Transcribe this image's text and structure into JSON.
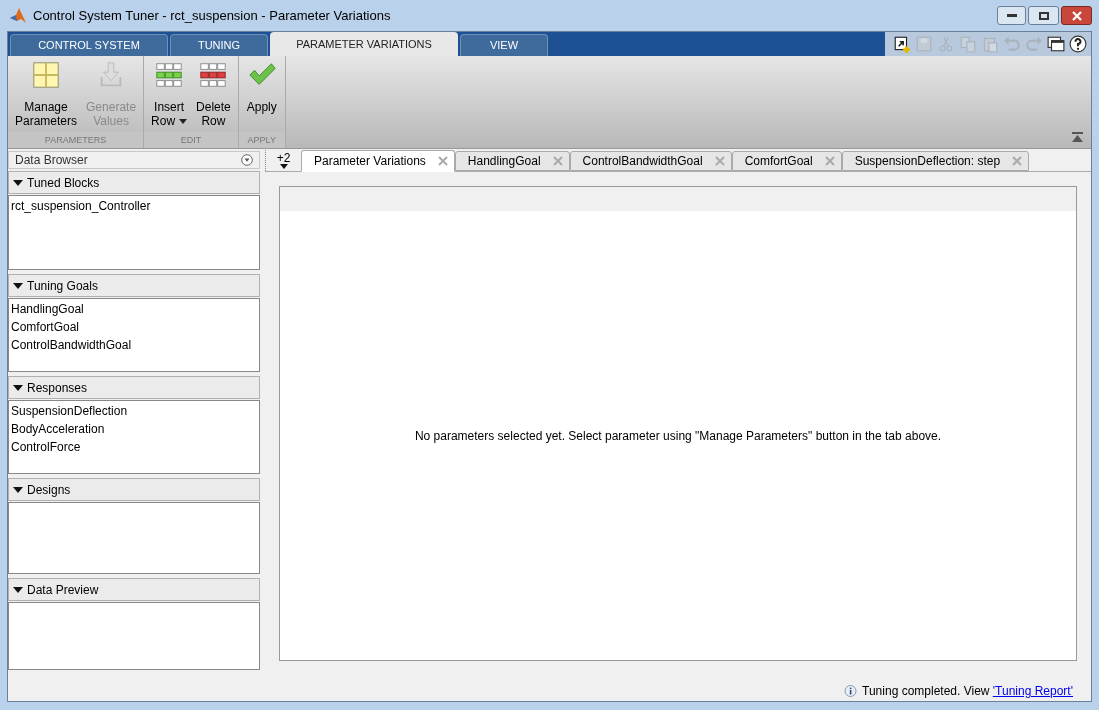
{
  "window": {
    "title": "Control System Tuner - rct_suspension - Parameter Variations"
  },
  "ribbon_tabs": [
    {
      "label": "CONTROL SYSTEM",
      "selected": false
    },
    {
      "label": "TUNING",
      "selected": false
    },
    {
      "label": "PARAMETER VARIATIONS",
      "selected": true
    },
    {
      "label": "VIEW",
      "selected": false
    }
  ],
  "quick_access": [
    {
      "kind": "new",
      "disabled": false
    },
    {
      "kind": "save",
      "disabled": true
    },
    {
      "kind": "cut",
      "disabled": true
    },
    {
      "kind": "copy",
      "disabled": true
    },
    {
      "kind": "paste",
      "disabled": true
    },
    {
      "kind": "undo",
      "disabled": true
    },
    {
      "kind": "redo",
      "disabled": true
    },
    {
      "kind": "windows",
      "disabled": false
    },
    {
      "kind": "help",
      "disabled": false
    }
  ],
  "ribbon_groups": [
    {
      "label": "PARAMETERS",
      "buttons": [
        {
          "kind": "grid",
          "label": [
            "Manage",
            "Parameters"
          ],
          "disabled": false,
          "dropdown": false
        },
        {
          "kind": "download",
          "label": [
            "Generate",
            "Values"
          ],
          "disabled": true,
          "dropdown": false
        }
      ]
    },
    {
      "label": "EDIT",
      "buttons": [
        {
          "kind": "insert",
          "label": [
            "Insert",
            "Row"
          ],
          "disabled": false,
          "dropdown": true
        },
        {
          "kind": "delete",
          "label": [
            "Delete",
            "Row"
          ],
          "disabled": false,
          "dropdown": false
        }
      ]
    },
    {
      "label": "APPLY",
      "buttons": [
        {
          "kind": "check",
          "label": [
            "Apply"
          ],
          "disabled": false,
          "dropdown": false
        }
      ]
    }
  ],
  "data_browser": {
    "title": "Data Browser",
    "sections": [
      {
        "title": "Tuned Blocks",
        "expanded": true,
        "items": [
          "rct_suspension_Controller"
        ]
      },
      {
        "title": "Tuning Goals",
        "expanded": true,
        "items": [
          "HandlingGoal",
          "ComfortGoal",
          "ControlBandwidthGoal"
        ]
      },
      {
        "title": "Responses",
        "expanded": true,
        "items": [
          "SuspensionDeflection",
          "BodyAcceleration",
          "ControlForce"
        ]
      },
      {
        "title": "Designs",
        "expanded": true
      },
      {
        "title": "Data Preview",
        "expanded": true
      }
    ]
  },
  "document_tabs": {
    "overflow": "+2",
    "tabs": [
      {
        "label": "Parameter Variations",
        "selected": true
      },
      {
        "label": "HandlingGoal",
        "selected": false
      },
      {
        "label": "ControlBandwidthGoal",
        "selected": false
      },
      {
        "label": "ComfortGoal",
        "selected": false
      },
      {
        "label": "SuspensionDeflection: step",
        "selected": false
      }
    ]
  },
  "document": {
    "message": "No parameters selected yet. Select parameter using \"Manage Parameters\" button in the tab above."
  },
  "status_bar": {
    "text": "Tuning completed. View",
    "link": "'Tuning Report'"
  }
}
